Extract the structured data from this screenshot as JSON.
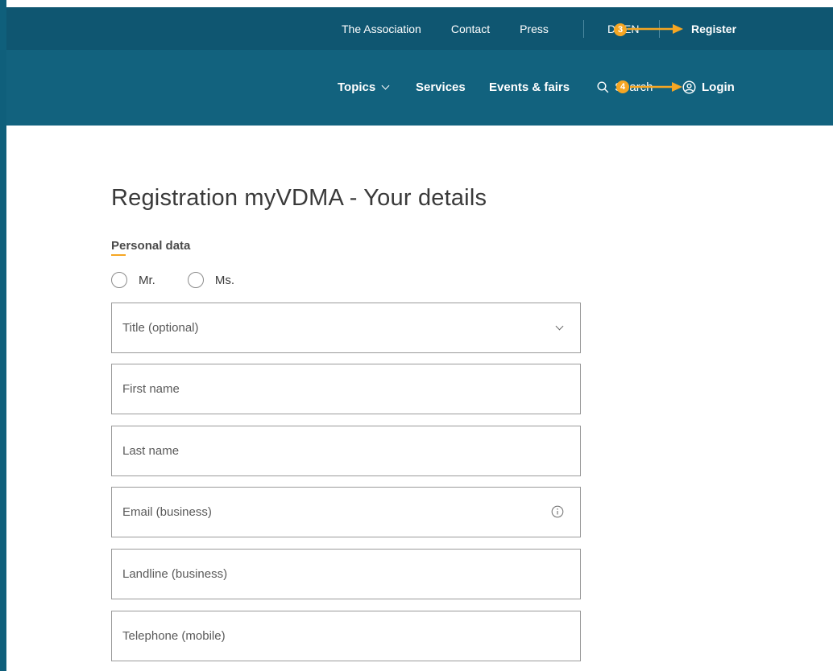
{
  "header": {
    "top_links": [
      "The Association",
      "Contact",
      "Press"
    ],
    "lang_de": "D",
    "lang_en": "EN",
    "register": "Register",
    "nav": {
      "topics": "Topics",
      "services": "Services",
      "events": "Events & fairs",
      "search": "Search",
      "login": "Login"
    }
  },
  "annotations": {
    "marker_3": "3",
    "marker_4": "4",
    "color": "#f5a623"
  },
  "form": {
    "title": "Registration myVDMA - Your details",
    "section_label": "Personal data",
    "salutation_options": [
      "Mr.",
      "Ms."
    ],
    "title_select": "Title (optional)",
    "first_name_placeholder": "First name",
    "last_name_placeholder": "Last name",
    "email_placeholder": "Email (business)",
    "landline_placeholder": "Landline (business)",
    "mobile_placeholder": "Telephone (mobile)"
  },
  "colors": {
    "header_top": "#0f5671",
    "header_bottom": "#12627e",
    "accent": "#f5a623"
  }
}
